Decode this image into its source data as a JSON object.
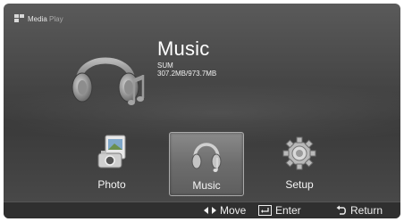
{
  "app": {
    "brand_label": "Media",
    "brand_sublabel": "Play"
  },
  "content": {
    "title": "Music",
    "device_name": "SUM",
    "storage": "307.2MB/973.7MB"
  },
  "menu": {
    "items": [
      {
        "label": "Photo",
        "icon": "photo-icon",
        "selected": false
      },
      {
        "label": "Music",
        "icon": "headphones-icon",
        "selected": true
      },
      {
        "label": "Setup",
        "icon": "gear-icon",
        "selected": false
      }
    ]
  },
  "footer": {
    "move_label": "Move",
    "enter_label": "Enter",
    "return_label": "Return"
  },
  "colors": {
    "background": "#444444",
    "selected_tile": "#7a7a7a",
    "footer_bar": "#2f2f2f",
    "text": "#ffffff"
  }
}
